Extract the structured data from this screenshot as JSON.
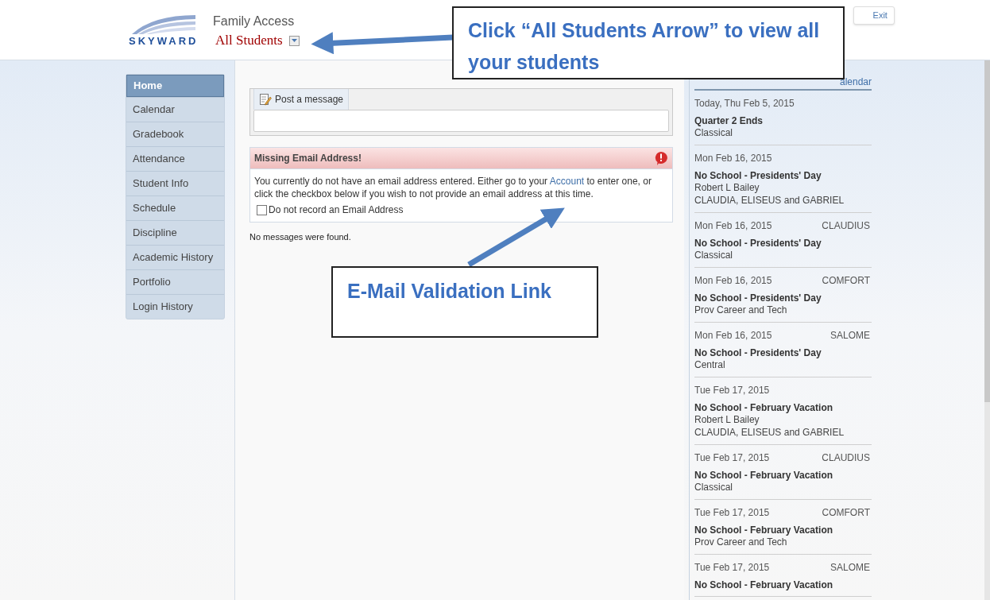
{
  "header": {
    "logo_text": "SKYWARD",
    "app_title": "Family Access",
    "student_selector": "All Students",
    "exit_button": "Exit"
  },
  "nav": [
    {
      "label": "Home",
      "selected": true
    },
    {
      "label": "Calendar",
      "selected": false
    },
    {
      "label": "Gradebook",
      "selected": false
    },
    {
      "label": "Attendance",
      "selected": false
    },
    {
      "label": "Student Info",
      "selected": false
    },
    {
      "label": "Schedule",
      "selected": false
    },
    {
      "label": "Discipline",
      "selected": false
    },
    {
      "label": "Academic History",
      "selected": false
    },
    {
      "label": "Portfolio",
      "selected": false
    },
    {
      "label": "Login History",
      "selected": false
    }
  ],
  "post_message": {
    "tab": "Post a message"
  },
  "alert": {
    "title": "Missing Email Address!",
    "text_before": "You currently do not have an email address entered. Either go to your",
    "link": "Account",
    "text_after": "to enter one, or click the checkbox below if you wish to not provide an email address at this time.",
    "checkbox": {
      "label": "Do not record an Email Address",
      "checked": false
    }
  },
  "no_messages": "No messages were found.",
  "events": {
    "calendar_link": "alendar",
    "items": [
      {
        "date": "Today, Thu Feb 5, 2015",
        "title": "Quarter 2 Ends",
        "lines": [
          "Classical"
        ]
      },
      {
        "date": "Mon Feb 16, 2015",
        "title": "No School - Presidents' Day",
        "lines": [
          "Robert L Bailey",
          "CLAUDIA, ELISEUS and GABRIEL"
        ]
      },
      {
        "date": "Mon Feb 16, 2015",
        "student": "CLAUDIUS",
        "title": "No School - Presidents' Day",
        "lines": [
          "Classical"
        ]
      },
      {
        "date": "Mon Feb 16, 2015",
        "student": "COMFORT",
        "title": "No School - Presidents' Day",
        "lines": [
          "Prov Career and Tech"
        ]
      },
      {
        "date": "Mon Feb 16, 2015",
        "student": "SALOME",
        "title": "No School - Presidents' Day",
        "lines": [
          "Central"
        ]
      },
      {
        "date": "Tue Feb 17, 2015",
        "title": "No School - February Vacation",
        "lines": [
          "Robert L Bailey",
          "CLAUDIA, ELISEUS and GABRIEL"
        ]
      },
      {
        "date": "Tue Feb 17, 2015",
        "student": "CLAUDIUS",
        "title": "No School - February Vacation",
        "lines": [
          "Classical"
        ]
      },
      {
        "date": "Tue Feb 17, 2015",
        "student": "COMFORT",
        "title": "No School - February Vacation",
        "lines": [
          "Prov Career and Tech"
        ]
      },
      {
        "date": "Tue Feb 17, 2015",
        "student": "SALOME",
        "title": "No School - February Vacation"
      }
    ]
  },
  "callouts": [
    {
      "text": "Click “All Students Arrow” to view all your students"
    },
    {
      "text": "E-Mail Validation Link"
    }
  ]
}
